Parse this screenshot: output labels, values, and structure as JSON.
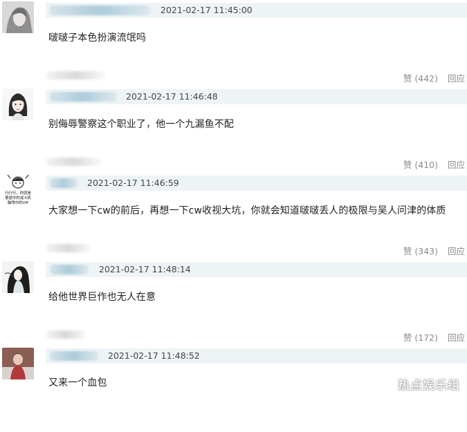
{
  "comments": [
    {
      "timestamp": "2021-02-17 11:45:00",
      "text": "啵啵子本色扮演流氓吗",
      "likes": "赞 (442)",
      "reply": "回应",
      "avatar_icon": "avatar-woman-gray"
    },
    {
      "timestamp": "2021-02-17 11:46:48",
      "text": "别侮辱警察这个职业了，他一个九漏鱼不配",
      "likes": "赞 (410)",
      "reply": "回应",
      "avatar_icon": "avatar-cartoon-girl"
    },
    {
      "timestamp": "2021-02-17 11:46:59",
      "text": "大家想一下cw的前后，再想一下cw收视大坑，你就会知道啵啵丢人的极限与吴人问津的体质",
      "likes": "赞 (343)",
      "reply": "回应",
      "avatar_icon": "avatar-meme-sticker",
      "avatar_caption": "行行行，你就是\n傻逼中的战斗机\n脑残中的VIP"
    },
    {
      "timestamp": "2021-02-17 11:48:14",
      "text": "给他世界巨作也无人在意",
      "likes": "赞 (172)",
      "reply": "回应",
      "avatar_icon": "avatar-ink-painting"
    },
    {
      "timestamp": "2021-02-17 11:48:52",
      "text": "又来一个血包",
      "likes": "",
      "reply": "",
      "avatar_icon": "avatar-photo"
    }
  ],
  "watermark": "热点娱乐组",
  "colors": {
    "meta_bar": "#eef4f6",
    "action_text": "#8a8a8a"
  }
}
